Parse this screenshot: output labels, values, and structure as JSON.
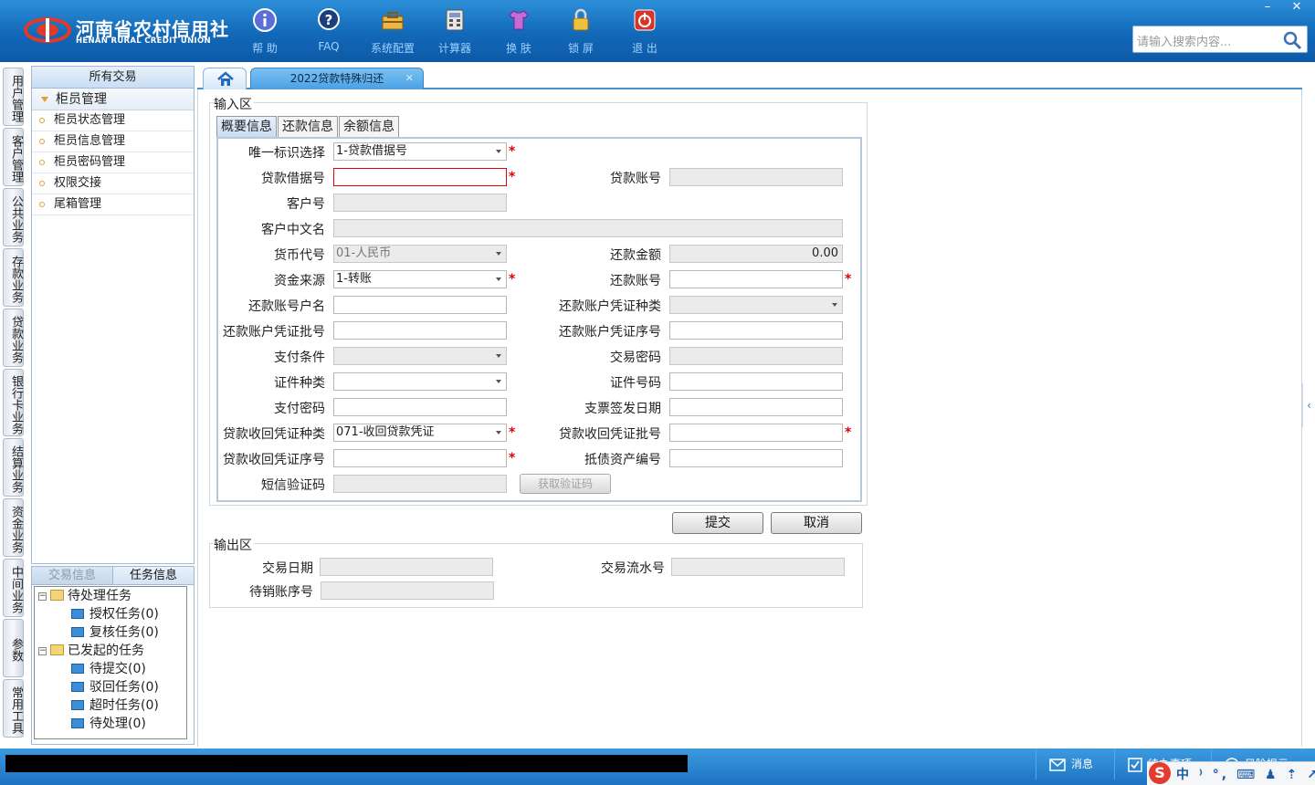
{
  "header": {
    "logo_cn": "河南省农村信用社",
    "logo_en": "HENAN RURAL CREDIT UNION",
    "toolbar": [
      {
        "label": "帮 助",
        "icon": "info-icon"
      },
      {
        "label": "FAQ",
        "icon": "question-icon"
      },
      {
        "label": "系统配置",
        "icon": "toolbox-icon"
      },
      {
        "label": "计算器",
        "icon": "calculator-icon"
      },
      {
        "label": "换 肤",
        "icon": "shirt-icon"
      },
      {
        "label": "锁 屏",
        "icon": "lock-icon"
      },
      {
        "label": "退 出",
        "icon": "power-icon"
      }
    ],
    "search_placeholder": "请输入搜索内容...",
    "win_minimize": "–",
    "win_close": "✕"
  },
  "vtabs": [
    "用户管理",
    "客户管理",
    "公共业务",
    "存款业务",
    "贷款业务",
    "银行卡业务",
    "结算业务",
    "资金业务",
    "中间业务",
    "参数",
    "常用工具"
  ],
  "menu": {
    "header": "所有交易",
    "group": "柜员管理",
    "items": [
      "柜员状态管理",
      "柜员信息管理",
      "柜员密码管理",
      "权限交接",
      "尾箱管理"
    ]
  },
  "task_panel": {
    "tab_inactive": "交易信息",
    "tab_active": "任务信息",
    "pm_minus": "−",
    "tree": {
      "pending": "待处理任务",
      "auth": "授权任务(0)",
      "review": "复核任务(0)",
      "started": "已发起的任务",
      "to_submit": "待提交(0)",
      "rejected": "驳回任务(0)",
      "timeout": "超时任务(0)",
      "to_process": "待处理(0)"
    }
  },
  "tabs": {
    "active_tab": "2022贷款特殊归还",
    "close": "✕"
  },
  "form": {
    "input_section": "输入区",
    "output_section": "输出区",
    "inner_tabs": [
      "概要信息",
      "还款信息",
      "余额信息"
    ],
    "required_mark": "*",
    "labels": {
      "unique_id": "唯一标识选择",
      "loan_receipt": "贷款借据号",
      "loan_account": "贷款账号",
      "customer_no": "客户号",
      "customer_name_cn": "客户中文名",
      "currency": "货币代号",
      "repay_amount": "还款金额",
      "fund_source": "资金来源",
      "repay_account": "还款账号",
      "repay_account_name": "还款账号户名",
      "repay_voucher_type": "还款账户凭证种类",
      "repay_voucher_batch": "还款账户凭证批号",
      "repay_voucher_seq": "还款账户凭证序号",
      "pay_condition": "支付条件",
      "trade_password": "交易密码",
      "id_type": "证件种类",
      "id_number": "证件号码",
      "pay_password": "支付密码",
      "check_date": "支票签发日期",
      "recover_voucher_type": "贷款收回凭证种类",
      "recover_voucher_batch": "贷款收回凭证批号",
      "recover_voucher_seq": "贷款收回凭证序号",
      "collateral_no": "抵债资产编号",
      "sms_code": "短信验证码"
    },
    "values": {
      "unique_id": "1-贷款借据号",
      "currency": "01-人民币",
      "repay_amount": "0.00",
      "fund_source": "1-转账",
      "recover_voucher_type": "071-收回贷款凭证"
    },
    "get_code_button": "获取验证码",
    "submit_button": "提交",
    "cancel_button": "取消",
    "output_labels": {
      "trade_date": "交易日期",
      "serial_no": "交易流水号",
      "pending_account_seq": "待销账序号"
    }
  },
  "side_arrow": "‹",
  "statusbar": {
    "message": "消息",
    "todo": "待办事项",
    "risk": "风险提示"
  },
  "ime": {
    "logo": "S",
    "indicators": "中 ⁾ °, ⌨ ♟ ⇡ ↗"
  }
}
